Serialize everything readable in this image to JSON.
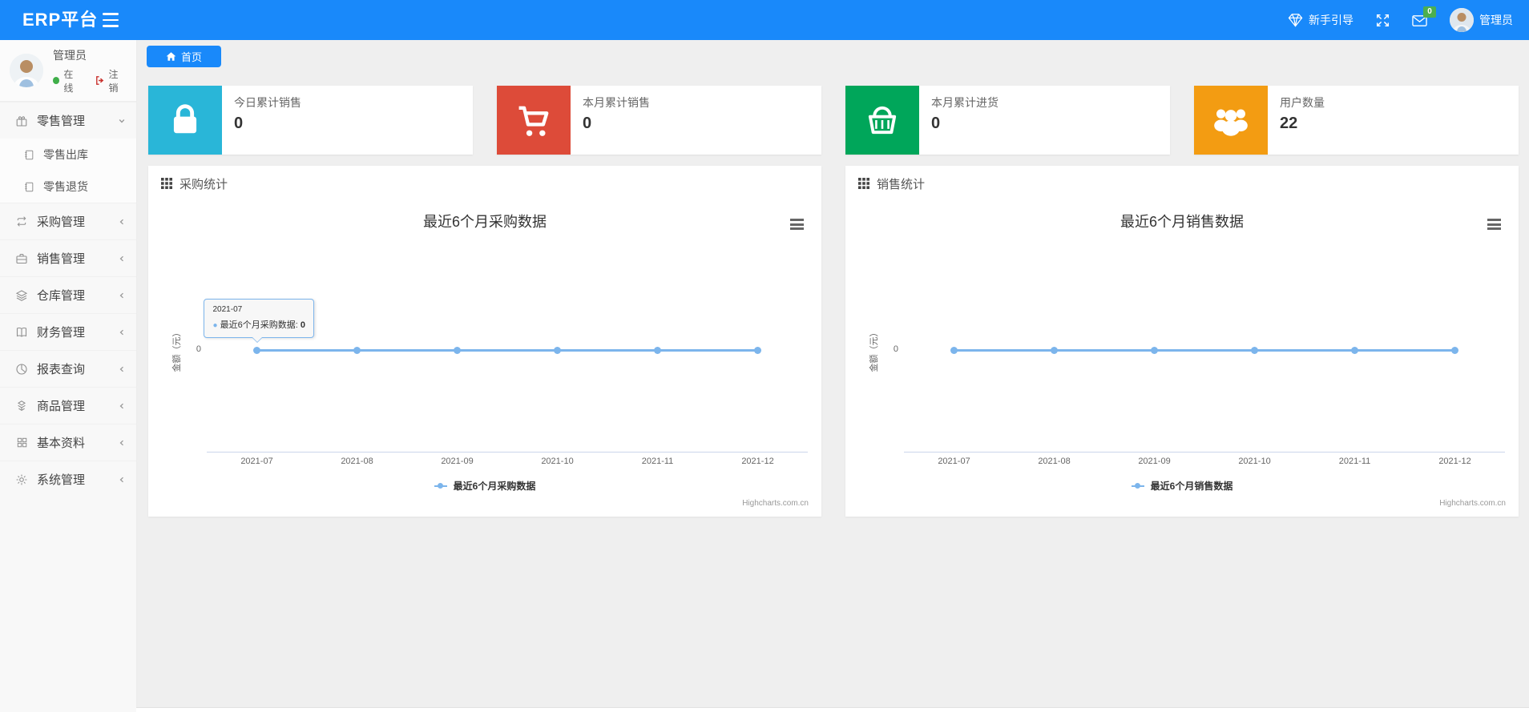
{
  "colors": {
    "header_blue": "#1989fa",
    "line_blue": "#7cb5ec",
    "badge_green": "#4caf50"
  },
  "header": {
    "brand": "ERP平台",
    "guide_label": "新手引导",
    "mail_badge": "0",
    "user_name": "管理员"
  },
  "sidebar": {
    "user": {
      "name": "管理员",
      "status": "在线",
      "logout": "注销"
    },
    "menu": [
      {
        "label": "零售管理"
      },
      {
        "label": "零售出库"
      },
      {
        "label": "零售退货"
      },
      {
        "label": "采购管理"
      },
      {
        "label": "销售管理"
      },
      {
        "label": "仓库管理"
      },
      {
        "label": "财务管理"
      },
      {
        "label": "报表查询"
      },
      {
        "label": "商品管理"
      },
      {
        "label": "基本资料"
      },
      {
        "label": "系统管理"
      }
    ]
  },
  "tabs": {
    "home": "首页"
  },
  "stat_cards": [
    {
      "label": "今日累计销售",
      "value": "0",
      "color": "#29b6d8",
      "icon": "bag-icon"
    },
    {
      "label": "本月累计销售",
      "value": "0",
      "color": "#dd4b39",
      "icon": "cart-icon"
    },
    {
      "label": "本月累计进货",
      "value": "0",
      "color": "#00a65a",
      "icon": "basket-icon"
    },
    {
      "label": "用户数量",
      "value": "22",
      "color": "#f39c12",
      "icon": "users-icon"
    }
  ],
  "panels": [
    {
      "title": "采购统计"
    },
    {
      "title": "销售统计"
    }
  ],
  "chart_data": [
    {
      "type": "line",
      "title": "最近6个月采购数据",
      "categories": [
        "2021-07",
        "2021-08",
        "2021-09",
        "2021-10",
        "2021-11",
        "2021-12"
      ],
      "series": [
        {
          "name": "最近6个月采购数据",
          "values": [
            0,
            0,
            0,
            0,
            0,
            0
          ]
        }
      ],
      "xlabel": "",
      "ylabel": "金额（元）",
      "ytick": "0",
      "ylim_tick_shown": 0,
      "grid": false,
      "legend_position": "bottom",
      "line_color": "#7cb5ec",
      "credits": "Highcharts.com.cn",
      "tooltip": {
        "visible": true,
        "category": "2021-07",
        "label": "最近6个月采购数据",
        "value": "0"
      }
    },
    {
      "type": "line",
      "title": "最近6个月销售数据",
      "categories": [
        "2021-07",
        "2021-08",
        "2021-09",
        "2021-10",
        "2021-11",
        "2021-12"
      ],
      "series": [
        {
          "name": "最近6个月销售数据",
          "values": [
            0,
            0,
            0,
            0,
            0,
            0
          ]
        }
      ],
      "xlabel": "",
      "ylabel": "金额（元）",
      "ytick": "0",
      "ylim_tick_shown": 0,
      "grid": false,
      "legend_position": "bottom",
      "line_color": "#7cb5ec",
      "credits": "Highcharts.com.cn",
      "tooltip": {
        "visible": false
      }
    }
  ]
}
